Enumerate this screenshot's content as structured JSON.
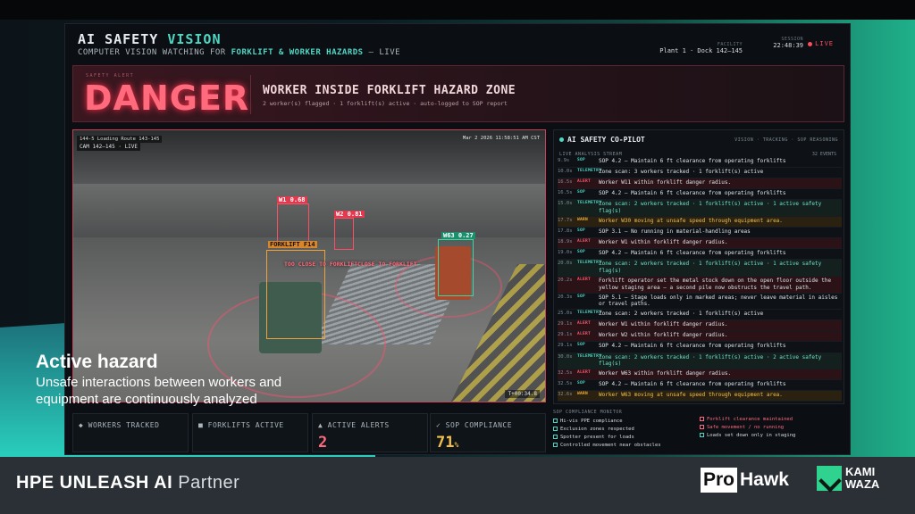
{
  "app": {
    "title_main": "AI SAFETY ",
    "title_accent": "VISION",
    "subtitle_pre": "COMPUTER VISION WATCHING FOR ",
    "subtitle_hl": "FORKLIFT & WORKER HAZARDS",
    "subtitle_post": " — LIVE",
    "facility_label": "FACILITY",
    "facility": "Plant 1 · Dock 142–145",
    "session_label": "SESSION",
    "clock": "22:48:39",
    "live": "LIVE"
  },
  "alert": {
    "tag": "SAFETY ALERT",
    "level": "DANGER",
    "headline": "WORKER INSIDE FORKLIFT HAZARD ZONE",
    "detail": "2 worker(s) flagged · 1 forklift(s) active · auto-logged to SOP report"
  },
  "video": {
    "cam_meta": "144-5 Loading Route 143-145",
    "cam_label": "CAM 142–145 · LIVE",
    "timestamp": "Mar 2 2026 11:58:51 AM CST",
    "elapsed": "T+00:34.8",
    "boxes": [
      {
        "label": "W1 0.68",
        "kind": "r"
      },
      {
        "label": "W2 0.81",
        "kind": "r"
      },
      {
        "label": "W63 0.27",
        "kind": "g"
      },
      {
        "label": "FORKLIFT F14",
        "kind": "o"
      }
    ],
    "too_close_1": "TOO CLOSE TO FORKLIFT",
    "too_close_2": "CLOSE TO FORKLIFT"
  },
  "stats": {
    "workers_label": "◆ WORKERS TRACKED",
    "forklifts_label": "■ FORKLIFTS ACTIVE",
    "alerts_label": "▲ ACTIVE ALERTS",
    "alerts_value": "2",
    "sop_label": "✓ SOP COMPLIANCE",
    "sop_value": "71",
    "sop_unit": "%"
  },
  "copilot": {
    "title": "AI SAFETY CO-PILOT",
    "modes": "VISION · TRACKING · SOP REASONING",
    "stream_label": "LIVE ANALYSIS STREAM",
    "events": "32 EVENTS",
    "log": [
      {
        "t": "9.9s",
        "type": "SOP",
        "cls": "sop",
        "msg": "SOP 4.2 — Maintain 6 ft clearance from operating forklifts"
      },
      {
        "t": "10.0s",
        "type": "TELEMETRY",
        "cls": "tele",
        "msg": "Zone scan: 3 workers tracked · 1 forklift(s) active"
      },
      {
        "t": "16.5s",
        "type": "ALERT",
        "cls": "alert",
        "msg": "Worker W11 within forklift danger radius."
      },
      {
        "t": "16.5s",
        "type": "SOP",
        "cls": "sop",
        "msg": "SOP 4.2 — Maintain 6 ft clearance from operating forklifts"
      },
      {
        "t": "15.0s",
        "type": "TELEMETRY",
        "cls": "tele flag",
        "msg": "Zone scan: 2 workers tracked · 1 forklift(s) active · 1 active safety flag(s)"
      },
      {
        "t": "17.7s",
        "type": "WARN",
        "cls": "warn",
        "msg": "Worker W30 moving at unsafe speed through equipment area."
      },
      {
        "t": "17.8s",
        "type": "SOP",
        "cls": "sop",
        "msg": "SOP 3.1 — No running in material-handling areas"
      },
      {
        "t": "18.9s",
        "type": "ALERT",
        "cls": "alert",
        "msg": "Worker W1 within forklift danger radius."
      },
      {
        "t": "19.0s",
        "type": "SOP",
        "cls": "sop",
        "msg": "SOP 4.2 — Maintain 6 ft clearance from operating forklifts"
      },
      {
        "t": "20.0s",
        "type": "TELEMETRY",
        "cls": "tele flag",
        "msg": "Zone scan: 2 workers tracked · 1 forklift(s) active · 1 active safety flag(s)"
      },
      {
        "t": "20.2s",
        "type": "ALERT",
        "cls": "alert",
        "msg": "Forklift operator set the metal stock down on the open floor outside the yellow staging area — a second pile now obstructs the travel path."
      },
      {
        "t": "20.3s",
        "type": "SOP",
        "cls": "sop",
        "msg": "SOP 5.1 — Stage loads only in marked areas; never leave material in aisles or travel paths."
      },
      {
        "t": "25.0s",
        "type": "TELEMETRY",
        "cls": "tele",
        "msg": "Zone scan: 2 workers tracked · 1 forklift(s) active"
      },
      {
        "t": "29.1s",
        "type": "ALERT",
        "cls": "alert",
        "msg": "Worker W1 within forklift danger radius."
      },
      {
        "t": "29.1s",
        "type": "ALERT",
        "cls": "alert",
        "msg": "Worker W2 within forklift danger radius."
      },
      {
        "t": "29.1s",
        "type": "SOP",
        "cls": "sop",
        "msg": "SOP 4.2 — Maintain 6 ft clearance from operating forklifts"
      },
      {
        "t": "30.0s",
        "type": "TELEMETRY",
        "cls": "tele flag",
        "msg": "Zone scan: 2 workers tracked · 1 forklift(s) active · 2 active safety flag(s)"
      },
      {
        "t": "32.5s",
        "type": "ALERT",
        "cls": "alert",
        "msg": "Worker W63 within forklift danger radius."
      },
      {
        "t": "32.5s",
        "type": "SOP",
        "cls": "sop",
        "msg": "SOP 4.2 — Maintain 6 ft clearance from operating forklifts"
      },
      {
        "t": "32.6s",
        "type": "WARN",
        "cls": "warn",
        "msg": "Worker W63 moving at unsafe speed through equipment area."
      },
      {
        "t": "32.6s",
        "type": "SOP",
        "cls": "sop",
        "msg": "SOP 3.1 — No running in material-handling areas"
      }
    ]
  },
  "compliance": {
    "title": "SOP COMPLIANCE MONITOR",
    "items": [
      {
        "label": "Hi-vis PPE compliance",
        "ok": true
      },
      {
        "label": "Exclusion zones respected",
        "ok": true
      },
      {
        "label": "Spotter present for loads",
        "ok": true
      },
      {
        "label": "Controlled movement near obstacles",
        "ok": true
      },
      {
        "label": "Forklift clearance maintained",
        "ok": false
      },
      {
        "label": "Safe movement / no running",
        "ok": false
      },
      {
        "label": "Loads set down only in staging",
        "ok": true
      }
    ]
  },
  "caption": {
    "title": "Active hazard",
    "line1": "Unsafe interactions between workers and",
    "line2": "equipment are continuously analyzed"
  },
  "footer": {
    "brand": "HPE UNLEASH AI",
    "partner": " Partner",
    "pro": "Pro",
    "hawk": "Hawk",
    "kami1": "KAMI",
    "kami2": "WAZA"
  }
}
